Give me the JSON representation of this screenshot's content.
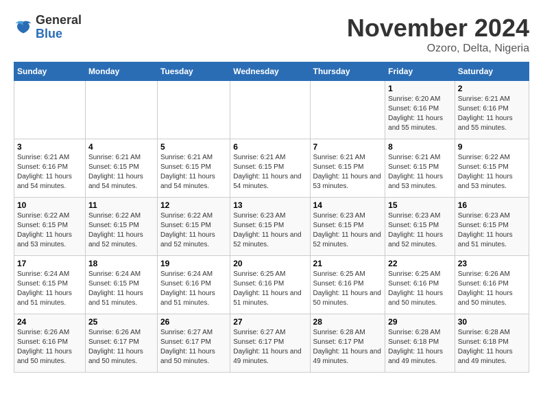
{
  "logo": {
    "general": "General",
    "blue": "Blue"
  },
  "header": {
    "title": "November 2024",
    "location": "Ozoro, Delta, Nigeria"
  },
  "weekdays": [
    "Sunday",
    "Monday",
    "Tuesday",
    "Wednesday",
    "Thursday",
    "Friday",
    "Saturday"
  ],
  "weeks": [
    [
      {
        "day": "",
        "info": ""
      },
      {
        "day": "",
        "info": ""
      },
      {
        "day": "",
        "info": ""
      },
      {
        "day": "",
        "info": ""
      },
      {
        "day": "",
        "info": ""
      },
      {
        "day": "1",
        "info": "Sunrise: 6:20 AM\nSunset: 6:16 PM\nDaylight: 11 hours and 55 minutes."
      },
      {
        "day": "2",
        "info": "Sunrise: 6:21 AM\nSunset: 6:16 PM\nDaylight: 11 hours and 55 minutes."
      }
    ],
    [
      {
        "day": "3",
        "info": "Sunrise: 6:21 AM\nSunset: 6:16 PM\nDaylight: 11 hours and 54 minutes."
      },
      {
        "day": "4",
        "info": "Sunrise: 6:21 AM\nSunset: 6:15 PM\nDaylight: 11 hours and 54 minutes."
      },
      {
        "day": "5",
        "info": "Sunrise: 6:21 AM\nSunset: 6:15 PM\nDaylight: 11 hours and 54 minutes."
      },
      {
        "day": "6",
        "info": "Sunrise: 6:21 AM\nSunset: 6:15 PM\nDaylight: 11 hours and 54 minutes."
      },
      {
        "day": "7",
        "info": "Sunrise: 6:21 AM\nSunset: 6:15 PM\nDaylight: 11 hours and 53 minutes."
      },
      {
        "day": "8",
        "info": "Sunrise: 6:21 AM\nSunset: 6:15 PM\nDaylight: 11 hours and 53 minutes."
      },
      {
        "day": "9",
        "info": "Sunrise: 6:22 AM\nSunset: 6:15 PM\nDaylight: 11 hours and 53 minutes."
      }
    ],
    [
      {
        "day": "10",
        "info": "Sunrise: 6:22 AM\nSunset: 6:15 PM\nDaylight: 11 hours and 53 minutes."
      },
      {
        "day": "11",
        "info": "Sunrise: 6:22 AM\nSunset: 6:15 PM\nDaylight: 11 hours and 52 minutes."
      },
      {
        "day": "12",
        "info": "Sunrise: 6:22 AM\nSunset: 6:15 PM\nDaylight: 11 hours and 52 minutes."
      },
      {
        "day": "13",
        "info": "Sunrise: 6:23 AM\nSunset: 6:15 PM\nDaylight: 11 hours and 52 minutes."
      },
      {
        "day": "14",
        "info": "Sunrise: 6:23 AM\nSunset: 6:15 PM\nDaylight: 11 hours and 52 minutes."
      },
      {
        "day": "15",
        "info": "Sunrise: 6:23 AM\nSunset: 6:15 PM\nDaylight: 11 hours and 52 minutes."
      },
      {
        "day": "16",
        "info": "Sunrise: 6:23 AM\nSunset: 6:15 PM\nDaylight: 11 hours and 51 minutes."
      }
    ],
    [
      {
        "day": "17",
        "info": "Sunrise: 6:24 AM\nSunset: 6:15 PM\nDaylight: 11 hours and 51 minutes."
      },
      {
        "day": "18",
        "info": "Sunrise: 6:24 AM\nSunset: 6:15 PM\nDaylight: 11 hours and 51 minutes."
      },
      {
        "day": "19",
        "info": "Sunrise: 6:24 AM\nSunset: 6:16 PM\nDaylight: 11 hours and 51 minutes."
      },
      {
        "day": "20",
        "info": "Sunrise: 6:25 AM\nSunset: 6:16 PM\nDaylight: 11 hours and 51 minutes."
      },
      {
        "day": "21",
        "info": "Sunrise: 6:25 AM\nSunset: 6:16 PM\nDaylight: 11 hours and 50 minutes."
      },
      {
        "day": "22",
        "info": "Sunrise: 6:25 AM\nSunset: 6:16 PM\nDaylight: 11 hours and 50 minutes."
      },
      {
        "day": "23",
        "info": "Sunrise: 6:26 AM\nSunset: 6:16 PM\nDaylight: 11 hours and 50 minutes."
      }
    ],
    [
      {
        "day": "24",
        "info": "Sunrise: 6:26 AM\nSunset: 6:16 PM\nDaylight: 11 hours and 50 minutes."
      },
      {
        "day": "25",
        "info": "Sunrise: 6:26 AM\nSunset: 6:17 PM\nDaylight: 11 hours and 50 minutes."
      },
      {
        "day": "26",
        "info": "Sunrise: 6:27 AM\nSunset: 6:17 PM\nDaylight: 11 hours and 50 minutes."
      },
      {
        "day": "27",
        "info": "Sunrise: 6:27 AM\nSunset: 6:17 PM\nDaylight: 11 hours and 49 minutes."
      },
      {
        "day": "28",
        "info": "Sunrise: 6:28 AM\nSunset: 6:17 PM\nDaylight: 11 hours and 49 minutes."
      },
      {
        "day": "29",
        "info": "Sunrise: 6:28 AM\nSunset: 6:18 PM\nDaylight: 11 hours and 49 minutes."
      },
      {
        "day": "30",
        "info": "Sunrise: 6:28 AM\nSunset: 6:18 PM\nDaylight: 11 hours and 49 minutes."
      }
    ]
  ]
}
